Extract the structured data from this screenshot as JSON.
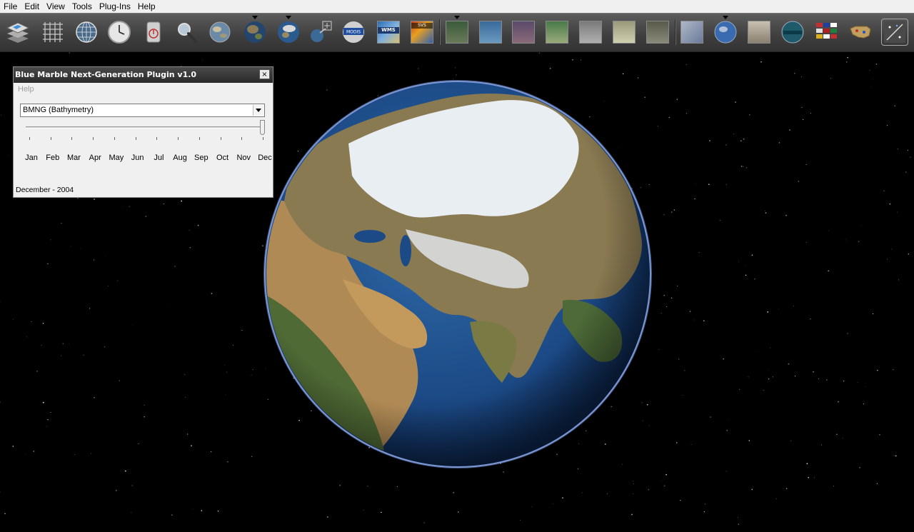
{
  "menu": [
    "File",
    "Edit",
    "View",
    "Tools",
    "Plug-Ins",
    "Help"
  ],
  "toolbar": {
    "buttons": [
      {
        "name": "layers-icon"
      },
      {
        "name": "lat-lon-grid-icon"
      },
      {
        "name": "place-names-icon"
      },
      {
        "name": "clock-icon"
      },
      {
        "name": "compass-icon"
      },
      {
        "name": "search-icon"
      },
      {
        "name": "blue-marble-icon"
      },
      {
        "name": "earth-dropdown-icon",
        "dropdown": true
      },
      {
        "name": "earth-view-dropdown-icon",
        "dropdown": true
      },
      {
        "name": "add-layer-icon"
      },
      {
        "name": "modis-icon"
      },
      {
        "name": "wms-icon",
        "label": "WMS"
      },
      {
        "name": "svs-icon",
        "label": "SVS"
      },
      {
        "name": "landsat-visible-icon",
        "dropdown": true
      },
      {
        "name": "landsat-pseudo-icon"
      },
      {
        "name": "landsat-pseudo-2-icon"
      },
      {
        "name": "landsat-pseudo-3-icon"
      },
      {
        "name": "usgs-urban-icon"
      },
      {
        "name": "usgs-topo-icon"
      },
      {
        "name": "usgs-urban-area-icon"
      },
      {
        "name": "map-icon"
      },
      {
        "name": "globe-dropdown-icon",
        "dropdown": true
      },
      {
        "name": "astrogeology-icon"
      },
      {
        "name": "landmarks-icon"
      },
      {
        "name": "flags-icon"
      },
      {
        "name": "us-map-icon"
      },
      {
        "name": "settings-icon"
      }
    ]
  },
  "plugin": {
    "title": "Blue Marble Next-Generation Plugin v1.0",
    "close": "×",
    "help": "Help",
    "dataset": "BMNG (Bathymetry)",
    "months": [
      "Jan",
      "Feb",
      "Mar",
      "Apr",
      "May",
      "Jun",
      "Jul",
      "Aug",
      "Sep",
      "Oct",
      "Nov",
      "Dec"
    ],
    "selected_month_index": 11,
    "date_label": "December - 2004"
  },
  "colors": {
    "space": "#000000",
    "toolbar": "#3e3e3e",
    "ocean": "#1e4f8c",
    "land": "#8a7a55"
  }
}
